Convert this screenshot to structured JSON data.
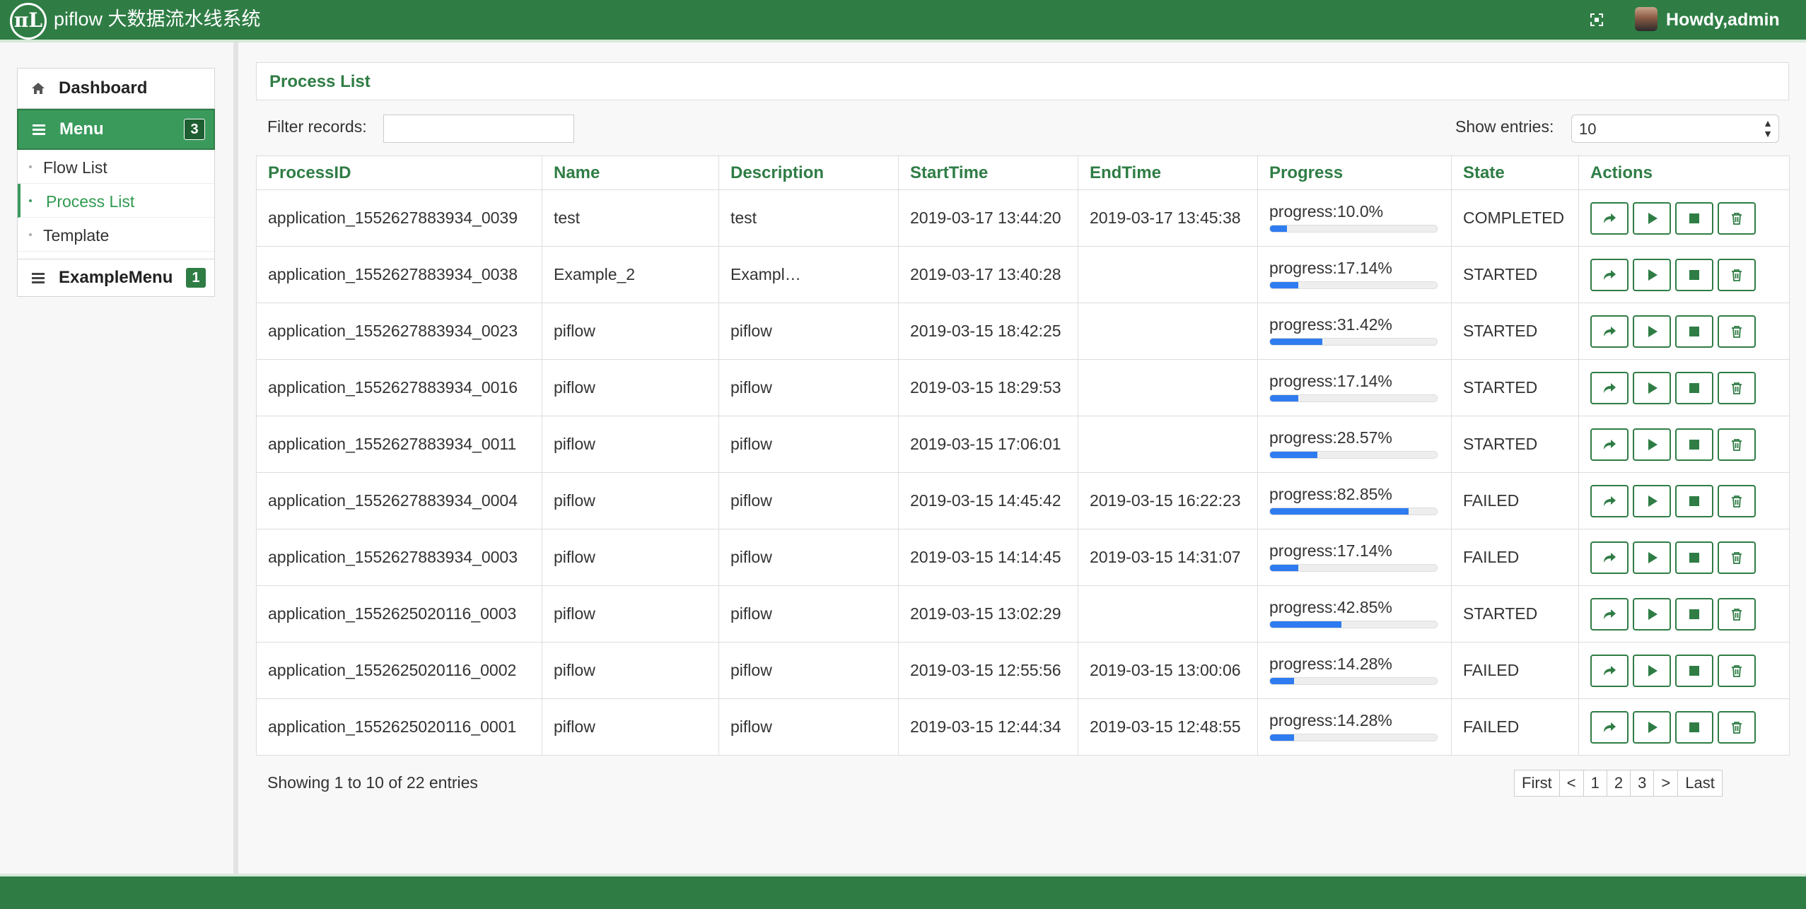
{
  "header": {
    "app_title": "piflow 大数据流水线系统",
    "logo_text": "πL",
    "user_greeting": "Howdy,admin"
  },
  "sidebar": {
    "dashboard": "Dashboard",
    "menu": {
      "label": "Menu",
      "badge": "3"
    },
    "submenu": [
      "Flow List",
      "Process List",
      "Template"
    ],
    "active_item": "Process List",
    "example_menu": {
      "label": "ExampleMenu",
      "badge": "1"
    }
  },
  "main": {
    "panel_title": "Process List",
    "filter_label": "Filter records:",
    "filter_value": "",
    "entries_label": "Show entries:",
    "entries_value": "10",
    "columns": [
      "ProcessID",
      "Name",
      "Description",
      "StartTime",
      "EndTime",
      "Progress",
      "State",
      "Actions"
    ],
    "rows": [
      {
        "id": "application_1552627883934_0039",
        "name": "test",
        "description": "test",
        "start": "2019-03-17\n13:44:20",
        "end": "2019-03-17\n13:45:38",
        "progress_text": "progress:10.0%",
        "progress": 10.0,
        "state": "COMPLETED"
      },
      {
        "id": "application_1552627883934_0038",
        "name": "Example_2",
        "description": "Exampl…",
        "start": "2019-03-17\n13:40:28",
        "end": "",
        "progress_text": "progress:17.14%",
        "progress": 17.14,
        "state": "STARTED"
      },
      {
        "id": "application_1552627883934_0023",
        "name": "piflow",
        "description": "piflow",
        "start": "2019-03-15\n18:42:25",
        "end": "",
        "progress_text": "progress:31.42%",
        "progress": 31.42,
        "state": "STARTED"
      },
      {
        "id": "application_1552627883934_0016",
        "name": "piflow",
        "description": "piflow",
        "start": "2019-03-15\n18:29:53",
        "end": "",
        "progress_text": "progress:17.14%",
        "progress": 17.14,
        "state": "STARTED"
      },
      {
        "id": "application_1552627883934_0011",
        "name": "piflow",
        "description": "piflow",
        "start": "2019-03-15\n17:06:01",
        "end": "",
        "progress_text": "progress:28.57%",
        "progress": 28.57,
        "state": "STARTED"
      },
      {
        "id": "application_1552627883934_0004",
        "name": "piflow",
        "description": "piflow",
        "start": "2019-03-15\n14:45:42",
        "end": "2019-03-15\n16:22:23",
        "progress_text": "progress:82.85%",
        "progress": 82.85,
        "state": "FAILED"
      },
      {
        "id": "application_1552627883934_0003",
        "name": "piflow",
        "description": "piflow",
        "start": "2019-03-15\n14:14:45",
        "end": "2019-03-15\n14:31:07",
        "progress_text": "progress:17.14%",
        "progress": 17.14,
        "state": "FAILED"
      },
      {
        "id": "application_1552625020116_0003",
        "name": "piflow",
        "description": "piflow",
        "start": "2019-03-15\n13:02:29",
        "end": "",
        "progress_text": "progress:42.85%",
        "progress": 42.85,
        "state": "STARTED"
      },
      {
        "id": "application_1552625020116_0002",
        "name": "piflow",
        "description": "piflow",
        "start": "2019-03-15\n12:55:56",
        "end": "2019-03-15\n13:00:06",
        "progress_text": "progress:14.28%",
        "progress": 14.28,
        "state": "FAILED"
      },
      {
        "id": "application_1552625020116_0001",
        "name": "piflow",
        "description": "piflow",
        "start": "2019-03-15\n12:44:34",
        "end": "2019-03-15\n12:48:55",
        "progress_text": "progress:14.28%",
        "progress": 14.28,
        "state": "FAILED"
      }
    ],
    "action_icons": [
      "share-icon",
      "play-icon",
      "stop-icon",
      "trash-icon"
    ],
    "showing_text": "Showing 1 to 10 of 22 entries",
    "pagination": [
      "First",
      "<",
      "1",
      "2",
      "3",
      ">",
      "Last"
    ]
  },
  "colors": {
    "brand_green": "#2f7d45",
    "menu_green": "#3a9a5c",
    "progress_blue": "#2f7cf0"
  }
}
